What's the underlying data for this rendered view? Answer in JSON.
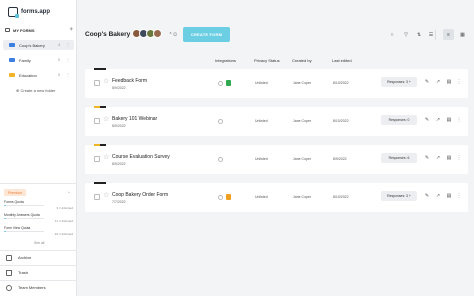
{
  "app": {
    "name": "forms.app"
  },
  "sidebar": {
    "section_title": "MY FORMS",
    "folders": [
      {
        "label": "Coop's Bakery",
        "count": "4",
        "color": "#3a7ee0",
        "active": true
      },
      {
        "label": "Family",
        "count": "0",
        "color": "#3a7ee0",
        "active": false
      },
      {
        "label": "Education",
        "count": "0",
        "color": "#f0b429",
        "active": false
      }
    ],
    "create_folder_label": "Create a new folder",
    "plan_badge": "Premium",
    "quotas": [
      {
        "label": "Forms Quota",
        "value": "3 / Unlimited",
        "progress": 0.05
      },
      {
        "label": "Monthly Answers Quota",
        "value": "11 / Unlimited",
        "progress": 0.05
      },
      {
        "label": "Form View Quota",
        "value": "29 / Unlimited",
        "progress": 0.05
      }
    ],
    "see_all_label": "See all",
    "links": [
      {
        "label": "Archive",
        "icon": "archive-icon"
      },
      {
        "label": "Trash",
        "icon": "trash-icon"
      },
      {
        "label": "Team Members",
        "icon": "team-icon"
      }
    ]
  },
  "header": {
    "folder_title": "Coop's Bakery",
    "create_button": "CREATE FORM",
    "avatar_colors": [
      "#8a5a3c",
      "#3c4a5a",
      "#6a7a3c",
      "#9a6a50"
    ]
  },
  "columns": {
    "integrations": "Integrations",
    "privacy": "Privacy Status",
    "created_by": "Created by",
    "last_edited": "Last edited"
  },
  "forms": [
    {
      "name": "Feedback Form",
      "date": "8/9/2022",
      "stripe": [
        "#222222",
        "#222222"
      ],
      "integration_color": "#2fa84f",
      "privacy": "Unlisted",
      "owner": "Jane Coper",
      "edited": "8/10/2022",
      "responses": "Responses: 3 +"
    },
    {
      "name": "Bakery 101 Webinar",
      "date": "8/9/2022",
      "stripe": [
        "#f0b429",
        "#222222"
      ],
      "integration_color": "",
      "privacy": "Unlisted",
      "owner": "Jane Coper",
      "edited": "8/10/2022",
      "responses": "Responses: 0"
    },
    {
      "name": "Course Evaluation Survey",
      "date": "8/9/2022",
      "stripe": [
        "#f0b429",
        "#222222"
      ],
      "integration_color": "",
      "privacy": "Unlisted",
      "owner": "Jane Coper",
      "edited": "8/9/2022",
      "responses": "Responses: 6"
    },
    {
      "name": "Coop Bakery Order Form",
      "date": "7/7/2022",
      "stripe": [
        "#222222",
        "#222222"
      ],
      "integration_color": "#f0a020",
      "privacy": "Unlisted",
      "owner": "Jane Coper",
      "edited": "8/10/2022",
      "responses": "Responses: 3 +"
    }
  ]
}
